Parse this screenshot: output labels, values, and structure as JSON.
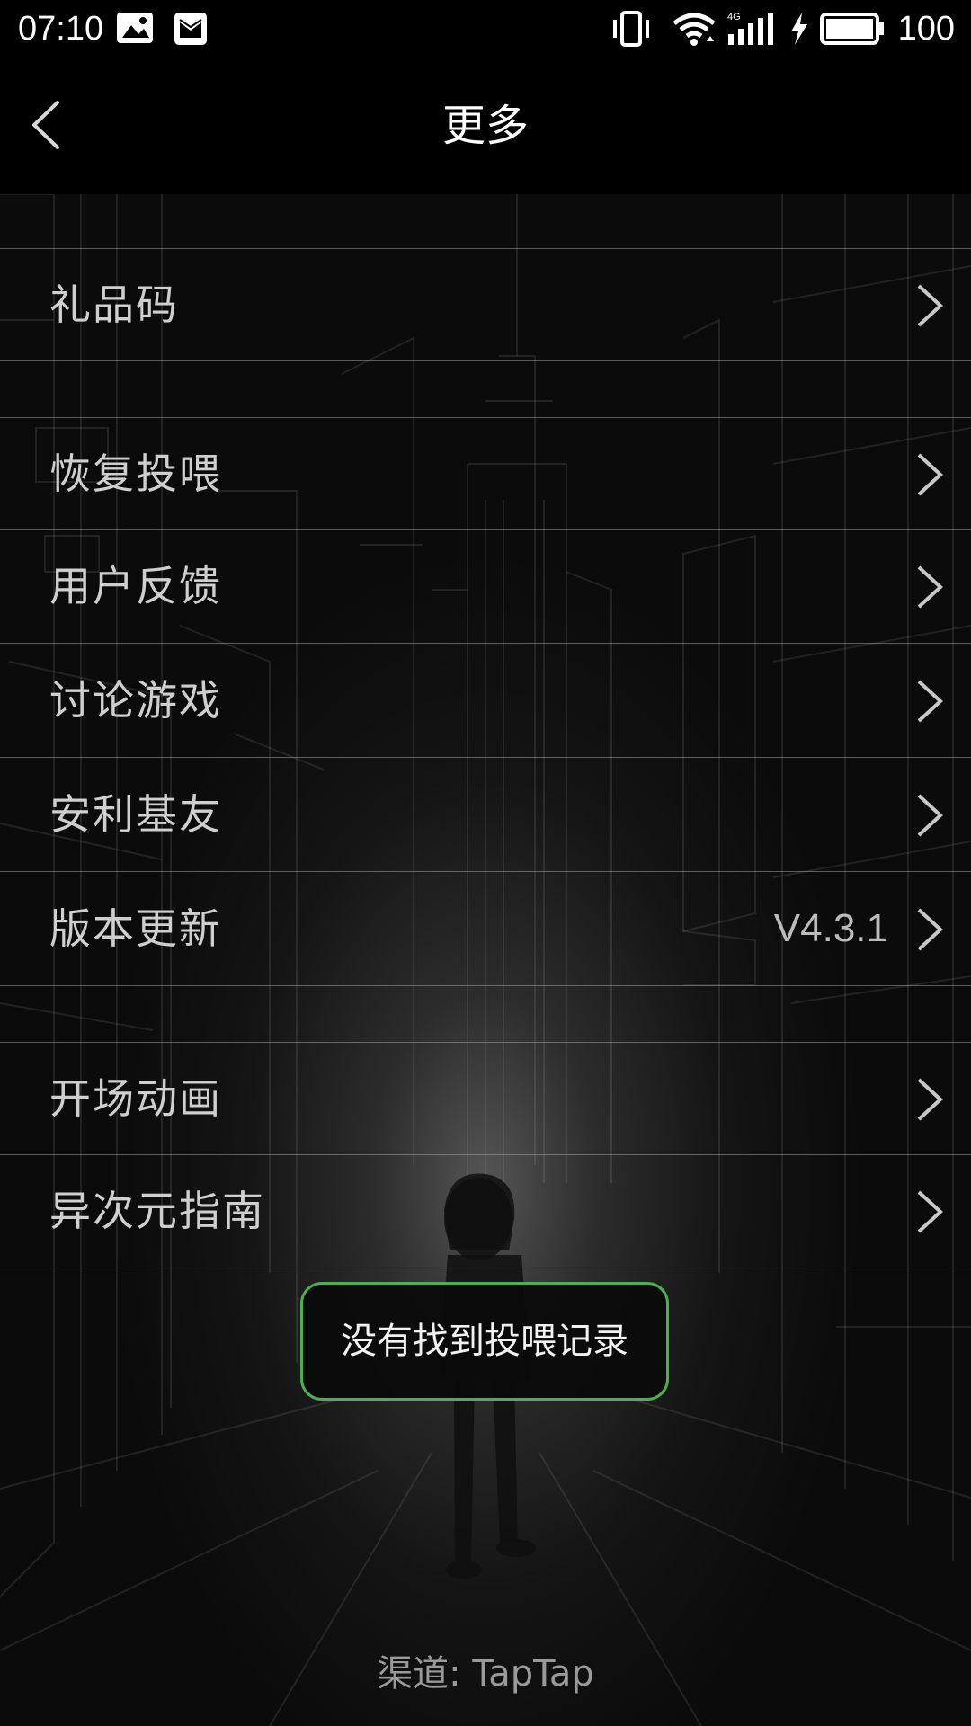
{
  "status_bar": {
    "time": "07:10",
    "left_icons": [
      "image-notification-icon",
      "mail-notification-icon"
    ],
    "right_icons": [
      "vibrate-icon",
      "wifi-icon",
      "signal-4g-icon",
      "charging-icon",
      "battery-icon"
    ],
    "network_label": "4G",
    "battery_level": "100"
  },
  "header": {
    "title": "更多",
    "back_icon": "chevron-left-icon"
  },
  "menu": {
    "items": [
      {
        "label": "礼品码"
      },
      {
        "label": "恢复投喂"
      },
      {
        "label": "用户反馈"
      },
      {
        "label": "讨论游戏"
      },
      {
        "label": "安利基友"
      },
      {
        "label": "版本更新",
        "value": "V4.3.1"
      },
      {
        "label": "开场动画"
      },
      {
        "label": "异次元指南"
      }
    ]
  },
  "toast": {
    "message": "没有找到投喂记录",
    "border_color": "#4caf50"
  },
  "footer": {
    "channel": "渠道: TapTap"
  }
}
